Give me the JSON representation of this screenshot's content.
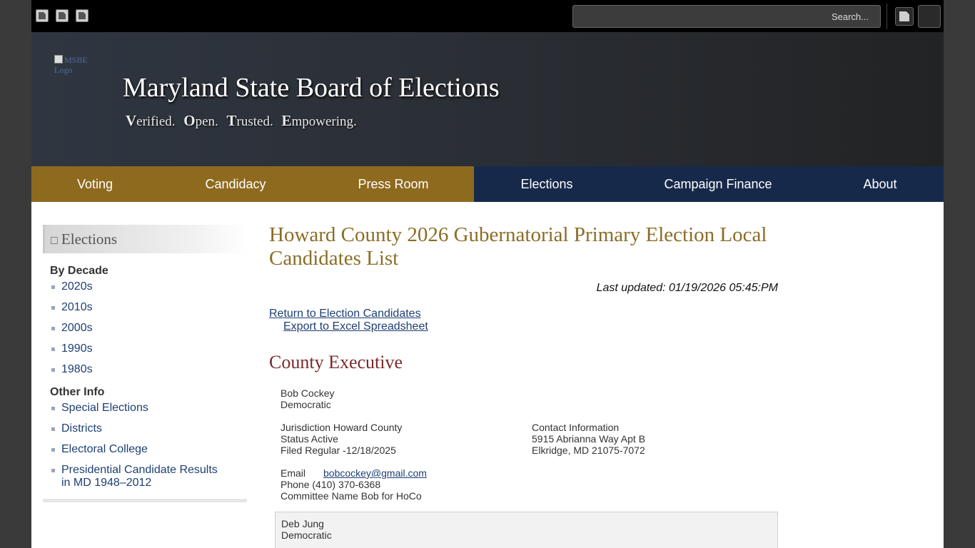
{
  "topbar": {
    "search_placeholder": "Search...",
    "icons": [
      "image-icon",
      "image-icon",
      "image-icon"
    ]
  },
  "header": {
    "logo_alt": "MSBE Logo",
    "title": "Maryland State Board of Elections",
    "tagline": [
      "Verified.",
      "Open.",
      "Trusted.",
      "Empowering."
    ]
  },
  "nav": {
    "items": [
      {
        "label": "Voting"
      },
      {
        "label": "Candidacy"
      },
      {
        "label": "Press Room"
      },
      {
        "label": "Elections"
      },
      {
        "label": "Campaign Finance"
      },
      {
        "label": "About"
      }
    ],
    "colors": {
      "gold": "#8e6a1f",
      "navy": "#17294a"
    }
  },
  "sidebar": {
    "title": "Elections",
    "title_icon": "square-icon",
    "by_decade_label": "By Decade",
    "decades": [
      "2020s",
      "2010s",
      "2000s",
      "1990s",
      "1980s"
    ],
    "other_info_label": "Other Info",
    "other": [
      "Special Elections",
      "Districts",
      "Electoral College",
      "Presidential Candidate Results in MD 1948–2012"
    ]
  },
  "main": {
    "title": "Howard County 2026 Gubernatorial Primary Election Local Candidates List",
    "last_updated": "Last updated: 01/19/2026 05:45:PM",
    "return_link": "Return to Election Candidates",
    "export_link": "Export to Excel Spreadsheet",
    "section": "County Executive",
    "candidates": [
      {
        "name": "Bob Cockey",
        "party": "Democratic",
        "jurisdiction": "Jurisdiction Howard County",
        "status": "Status Active",
        "filed": "Filed Regular -12/18/2025",
        "contact_label": "Contact Information",
        "address1": "5915 Abrianna Way Apt B",
        "address2": "Elkridge, MD 21075-7072",
        "email_label": "Email",
        "email": "bobcockey@gmail.com",
        "phone": "Phone (410) 370-6368",
        "committee": "Committee Name Bob for HoCo"
      },
      {
        "name": "Deb Jung",
        "party": "Democratic"
      }
    ]
  }
}
